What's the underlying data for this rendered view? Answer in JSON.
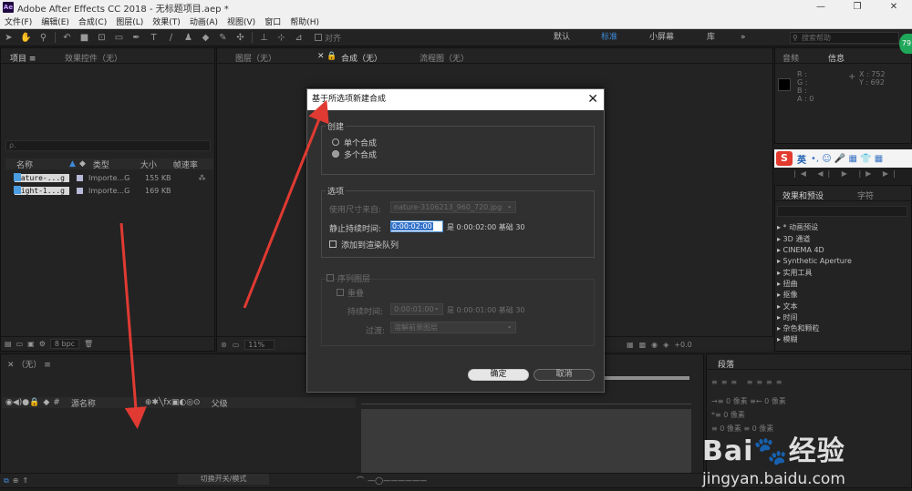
{
  "window": {
    "logo_text": "Ae",
    "title": "Adobe After Effects CC 2018 - 无标题项目.aep *",
    "minimize": "—",
    "maximize": "❐",
    "close": "✕"
  },
  "menu": [
    "文件(F)",
    "编辑(E)",
    "合成(C)",
    "图层(L)",
    "效果(T)",
    "动画(A)",
    "视图(V)",
    "窗口",
    "帮助(H)"
  ],
  "toolbar": {
    "snap_label": "对齐",
    "workspaces": [
      "默认",
      "标准",
      "小屏幕",
      "库"
    ],
    "active_workspace": "标准",
    "more": "»",
    "search_placeholder": "搜索帮助",
    "badge": "79"
  },
  "project": {
    "tab_project": "项目 ≡",
    "tab_effect_controls": "效果控件（无）",
    "search_placeholder": "ρ.",
    "columns": [
      "名称",
      "类型",
      "大小",
      "帧速率"
    ],
    "files": [
      {
        "name": "nature-...g",
        "type": "Importe...G",
        "size": "155 KB"
      },
      {
        "name": "night-1...g",
        "type": "Importe...G",
        "size": "169 KB"
      }
    ],
    "bpc": "8 bpc"
  },
  "viewer": {
    "tab_layer": "图层（无）",
    "tab_comp": "合成（无）",
    "tab_flow": "流程图（无）",
    "zoom": "11%",
    "exposure": "+0.0"
  },
  "info": {
    "tab_audio": "音频",
    "tab_info": "信息",
    "channels": "R :\nG :\nB :\nA : 0",
    "coords": "X : 752\nY : 692"
  },
  "ime": {
    "lang": "英",
    "extra": "•, ☺ 🎤 ▦ 👕 ▦"
  },
  "effects": {
    "tab_effects": "效果和预设",
    "tab_character": "字符",
    "items": [
      "▸ * 动画预设",
      "▸ 3D 通道",
      "▸ CINEMA 4D",
      "▸ Synthetic Aperture",
      "▸ 实用工具",
      "▸ 扭曲",
      "▸ 抠像",
      "▸ 文本",
      "▸ 时间",
      "▸ 杂色和颗粒",
      "▸ 模糊"
    ]
  },
  "timeline": {
    "tab": "（无）",
    "columns": [
      "源名称",
      "父级"
    ],
    "toggle": "切换开关/模式",
    "time_end": "01:01"
  },
  "paragraph": {
    "tab": "段落",
    "rows": [
      "→≡ 0 像素   ≡← 0 像素",
      "*≡ 0 像素",
      "≡ 0 像素   ≡ 0 像素"
    ]
  },
  "dialog": {
    "title": "基于所选项新建合成",
    "close": "✕",
    "create_group": "创建",
    "single_comp": "单个合成",
    "multi_comp": "多个合成",
    "options_group": "选项",
    "use_dims_label": "使用尺寸来自:",
    "use_dims_value": "nature-3106213_960_720.jpg",
    "still_duration_label": "静止持续时间:",
    "still_duration_value": "0:00:02:00",
    "still_duration_info": "是 0:00:02:00  基础 30",
    "add_render_queue": "添加到渲染队列",
    "sequence_layers": "序列图层",
    "overlap": "重叠",
    "duration_label": "持续时间:",
    "duration_value": "0:00:01:00",
    "duration_info": "是 0:00:01:00  基础 30",
    "transition_label": "过渡:",
    "transition_value": "溶解前景图层",
    "ok": "确定",
    "cancel": "取消"
  },
  "watermark": {
    "brand": "Bai🐾经验",
    "url": "jingyan.baidu.com"
  }
}
